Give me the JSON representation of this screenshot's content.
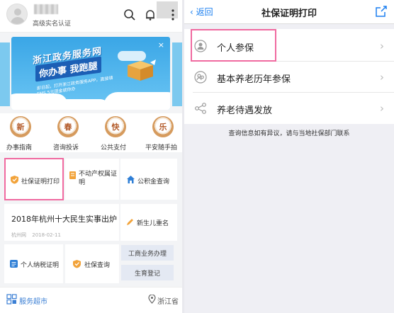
{
  "left": {
    "header": {
      "verify_text": "高级实名认证"
    },
    "banner": {
      "title": "浙江政务服务网",
      "slogan": "你办事 我跑腿",
      "subtext": "即日起，打开浙江政务服务APP，直接填EMS 5元现金就你办",
      "close": "×"
    },
    "services": [
      {
        "glyph": "新",
        "label": "办事指南"
      },
      {
        "glyph": "春",
        "label": "咨询投诉"
      },
      {
        "glyph": "快",
        "label": "公共支付"
      },
      {
        "glyph": "乐",
        "label": "平安随手拍"
      }
    ],
    "tiles": {
      "social_cert": "社保证明打印",
      "property": "不动产权属证明",
      "fund": "公积金查询",
      "newborn": "新生儿重名",
      "tax": "个人纳税证明",
      "social_query": "社保查询",
      "business": "工商业务办理",
      "birth": "生育登记"
    },
    "news": {
      "title": "2018年杭州十大民生实事出炉",
      "source": "杭州网",
      "date": "2018-02-11"
    },
    "footer": {
      "market": "服务超市",
      "location": "浙江省"
    }
  },
  "right": {
    "back": "返回",
    "title": "社保证明打印",
    "rows": [
      {
        "label": "个人参保"
      },
      {
        "label": "基本养老历年参保"
      },
      {
        "label": "养老待遇发放"
      }
    ],
    "notice": "查询信息如有异议，请与当地社保部门联系"
  },
  "colors": {
    "accent": "#1b7ff0",
    "highlight": "#f06aa0",
    "banner": "#3aa6e6"
  }
}
